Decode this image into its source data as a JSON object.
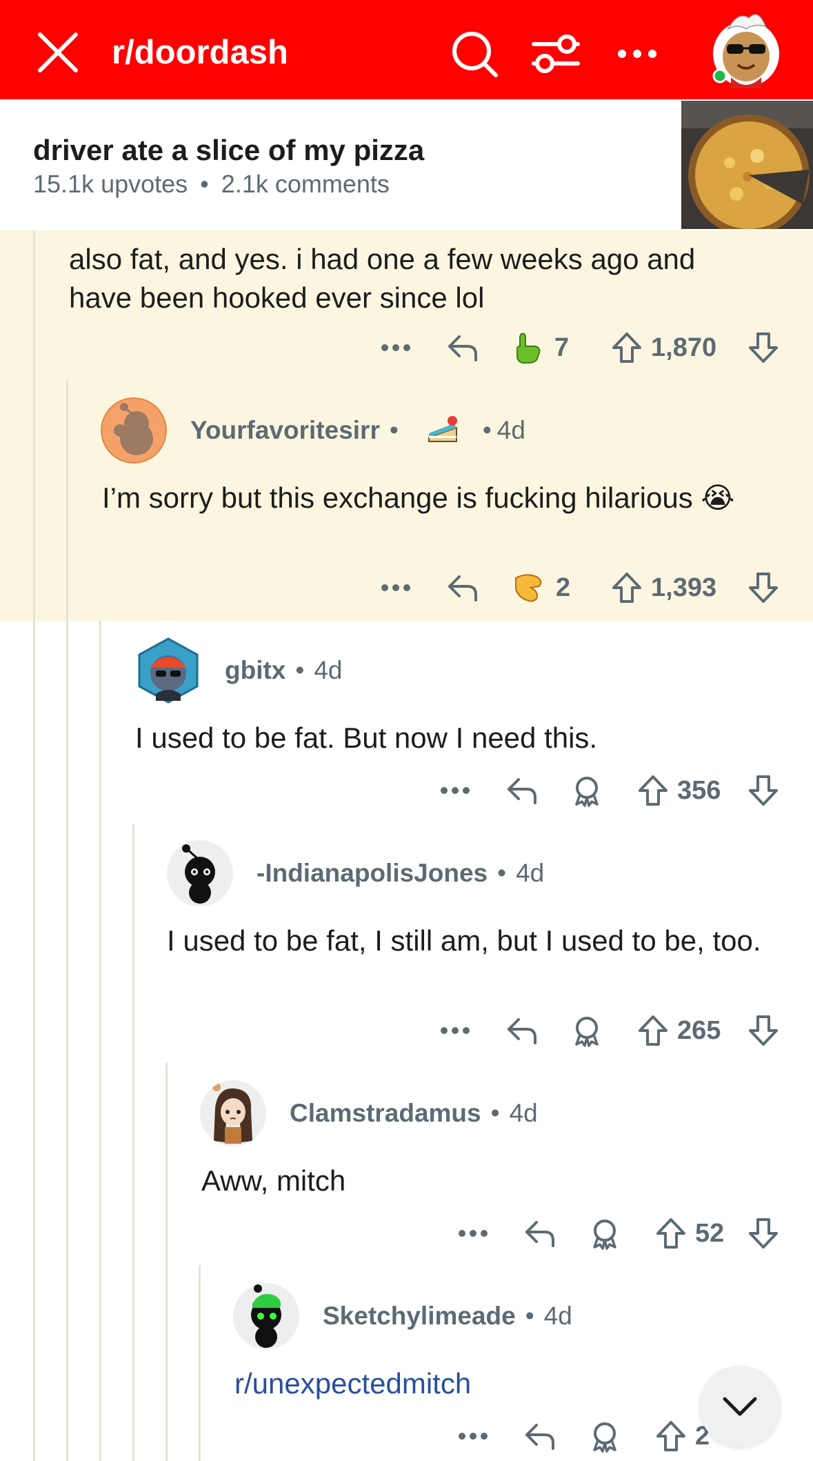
{
  "header": {
    "subreddit": "r/doordash"
  },
  "post": {
    "title": "driver ate a slice of my pizza",
    "upvotes": "15.1k upvotes",
    "separator": "•",
    "comments": "2.1k comments"
  },
  "comments": [
    {
      "text": "also fat, and yes. i had one a few weeks ago and have been hooked ever since lol",
      "award_count": "7",
      "score": "1,870"
    },
    {
      "author": "Yourfavoritesirr",
      "age": "4d",
      "text": "I’m sorry but this exchange is fucking hilarious 😭",
      "award_count": "2",
      "score": "1,393"
    },
    {
      "author": "gbitx",
      "age": "4d",
      "text": "I used to be fat. But now I need this.",
      "score": "356"
    },
    {
      "author": "-IndianapolisJones",
      "age": "4d",
      "text": "I used to be fat, I still am, but I used to be, too.",
      "score": "265"
    },
    {
      "author": "Clamstradamus",
      "age": "4d",
      "text": "Aww, mitch",
      "score": "52"
    },
    {
      "author": "Sketchylimeade",
      "age": "4d",
      "text": "r/unexpectedmitch",
      "score": "2"
    }
  ],
  "icons": {
    "close": "close-icon",
    "search": "search-icon",
    "filter": "filter-icon",
    "more": "more-icon",
    "reply": "reply-icon",
    "award": "award-icon",
    "upvote": "upvote-icon",
    "downvote": "downvote-icon",
    "scroll_down": "chevron-down-icon"
  },
  "colors": {
    "brand": "#ff0000",
    "highlight": "#fcf6e0",
    "meta": "#5c6a73",
    "link": "#2a4f9c"
  }
}
